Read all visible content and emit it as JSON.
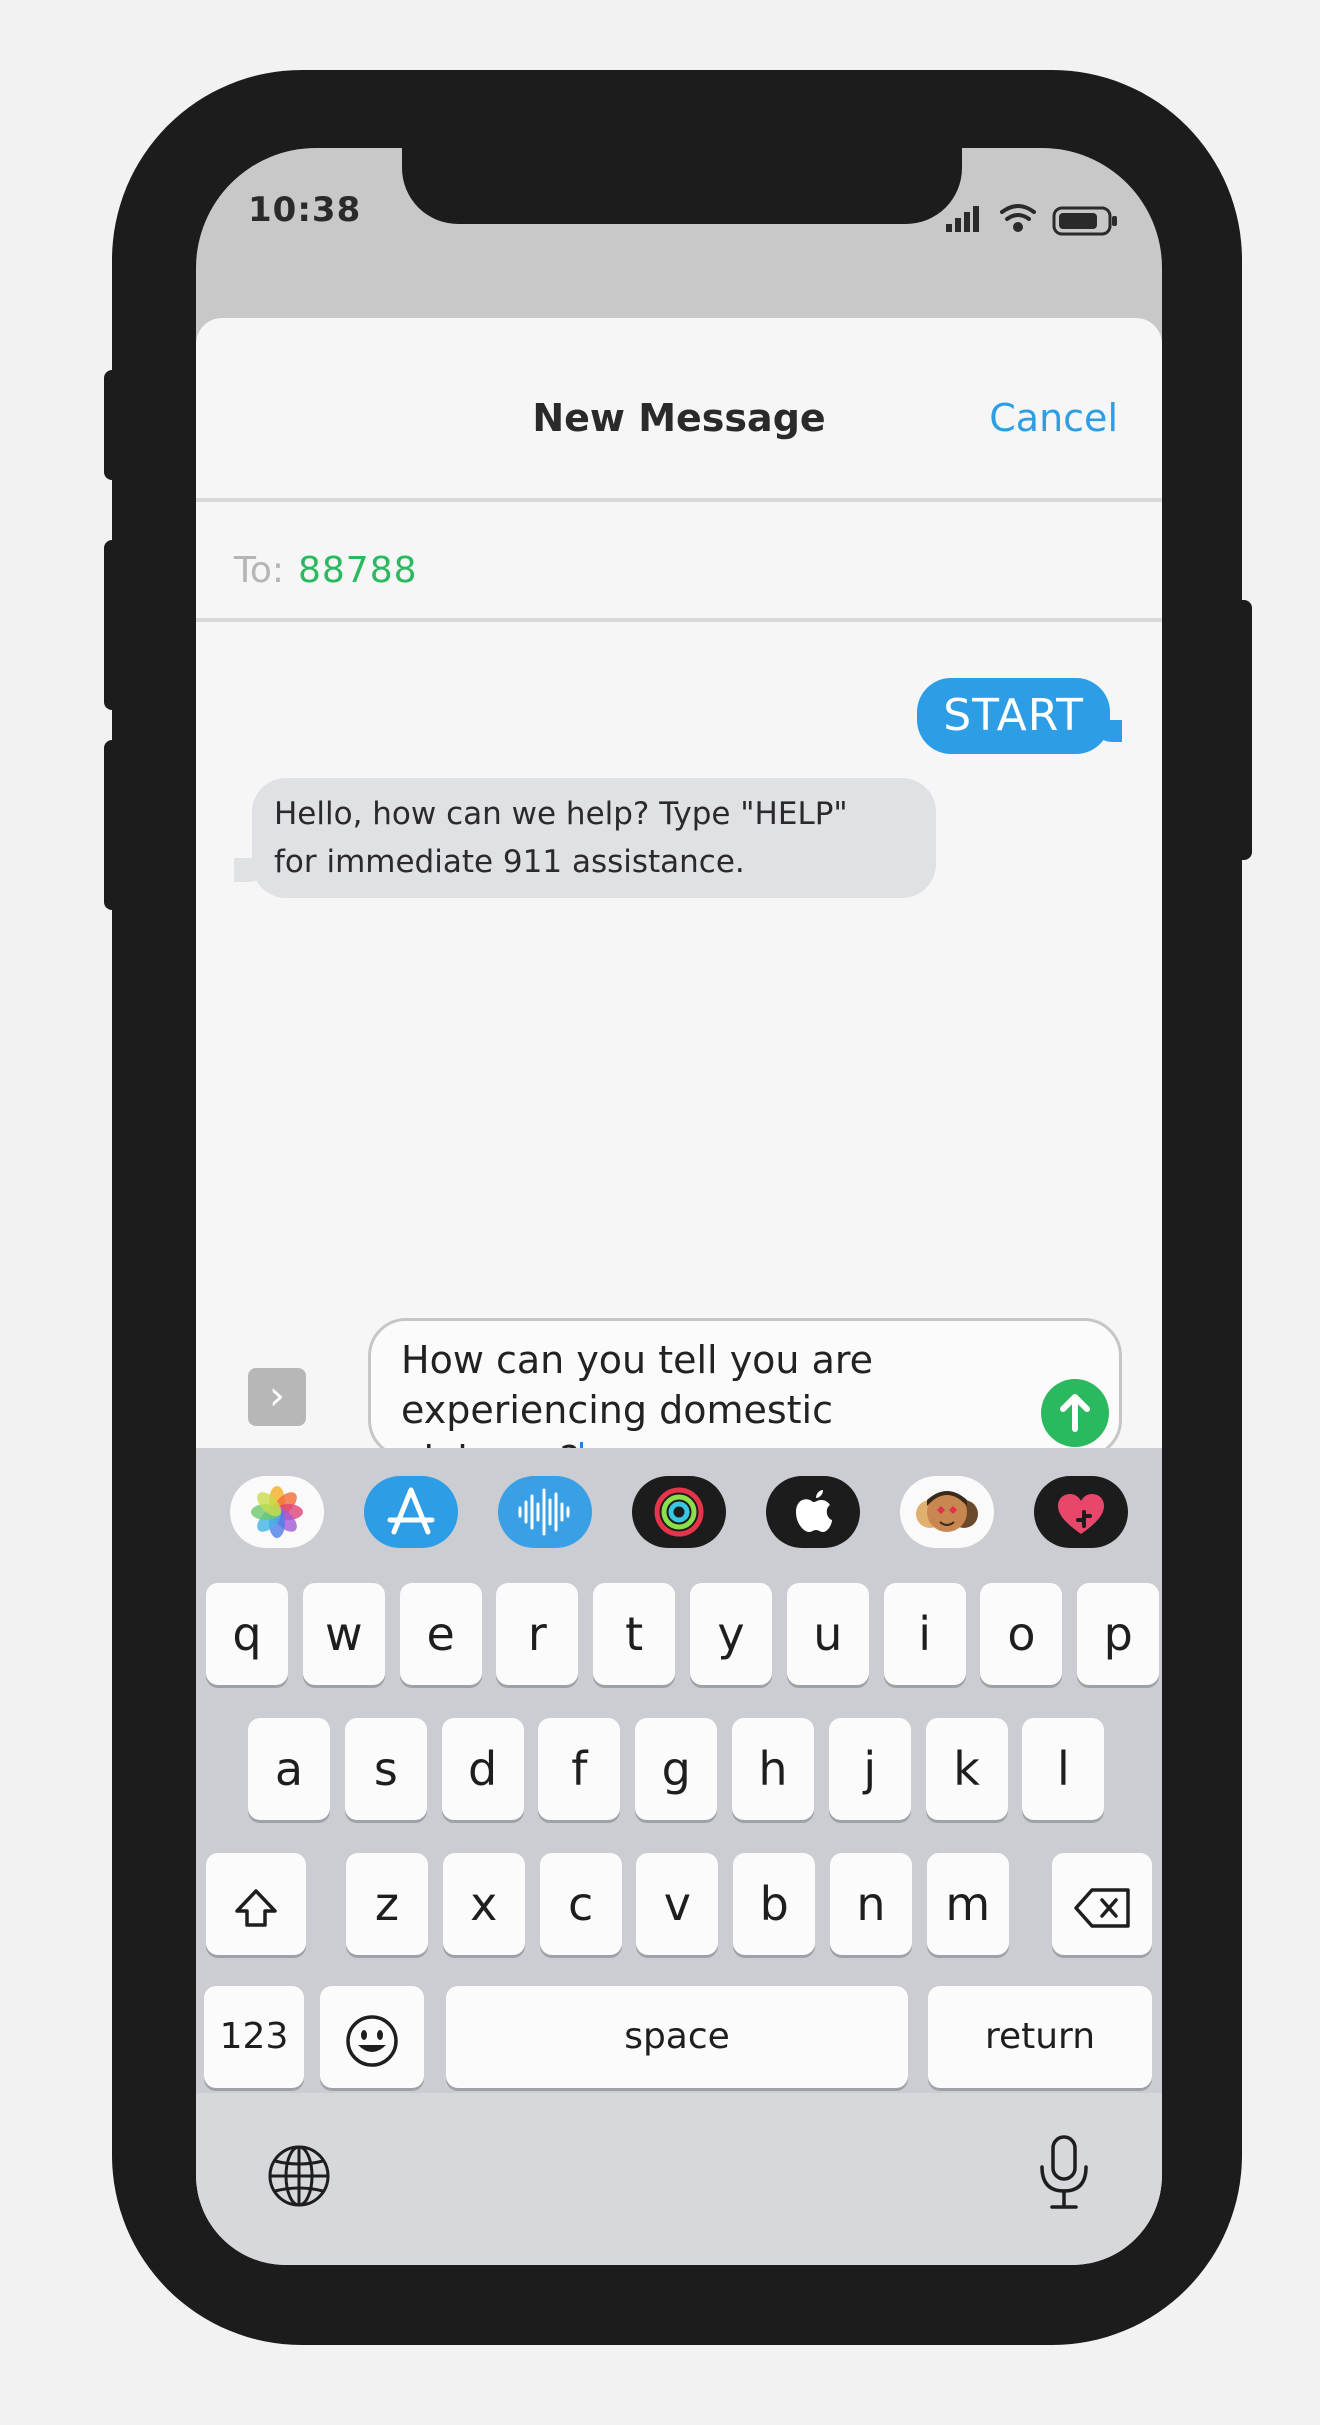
{
  "status_bar": {
    "time": "10:38"
  },
  "header": {
    "title": "New Message",
    "cancel_label": "Cancel"
  },
  "recipient": {
    "label": "To:",
    "value": "88788"
  },
  "messages": [
    {
      "direction": "sent",
      "text": "START"
    },
    {
      "direction": "received",
      "line1": "Hello, how can we help? Type \"HELP\"",
      "line2": "for immediate 911 assistance."
    }
  ],
  "composer": {
    "line1": "How can you tell you are",
    "line2": "experiencing domestic violence?"
  },
  "app_drawer": [
    {
      "name": "photos-icon"
    },
    {
      "name": "app-store-icon"
    },
    {
      "name": "audio-message-icon"
    },
    {
      "name": "activity-icon"
    },
    {
      "name": "apple-pay-icon"
    },
    {
      "name": "memoji-stickers-icon"
    },
    {
      "name": "digital-touch-icon"
    }
  ],
  "keyboard": {
    "row1": [
      "q",
      "w",
      "e",
      "r",
      "t",
      "y",
      "u",
      "i",
      "o",
      "p"
    ],
    "row2": [
      "a",
      "s",
      "d",
      "f",
      "g",
      "h",
      "j",
      "k",
      "l"
    ],
    "row3": [
      "z",
      "x",
      "c",
      "v",
      "b",
      "n",
      "m"
    ],
    "numbers_label": "123",
    "space_label": "space",
    "return_label": "return"
  },
  "colors": {
    "accent_blue": "#2d9ee6",
    "send_green": "#2bb960",
    "bubble_gray": "#dfe1e4"
  }
}
